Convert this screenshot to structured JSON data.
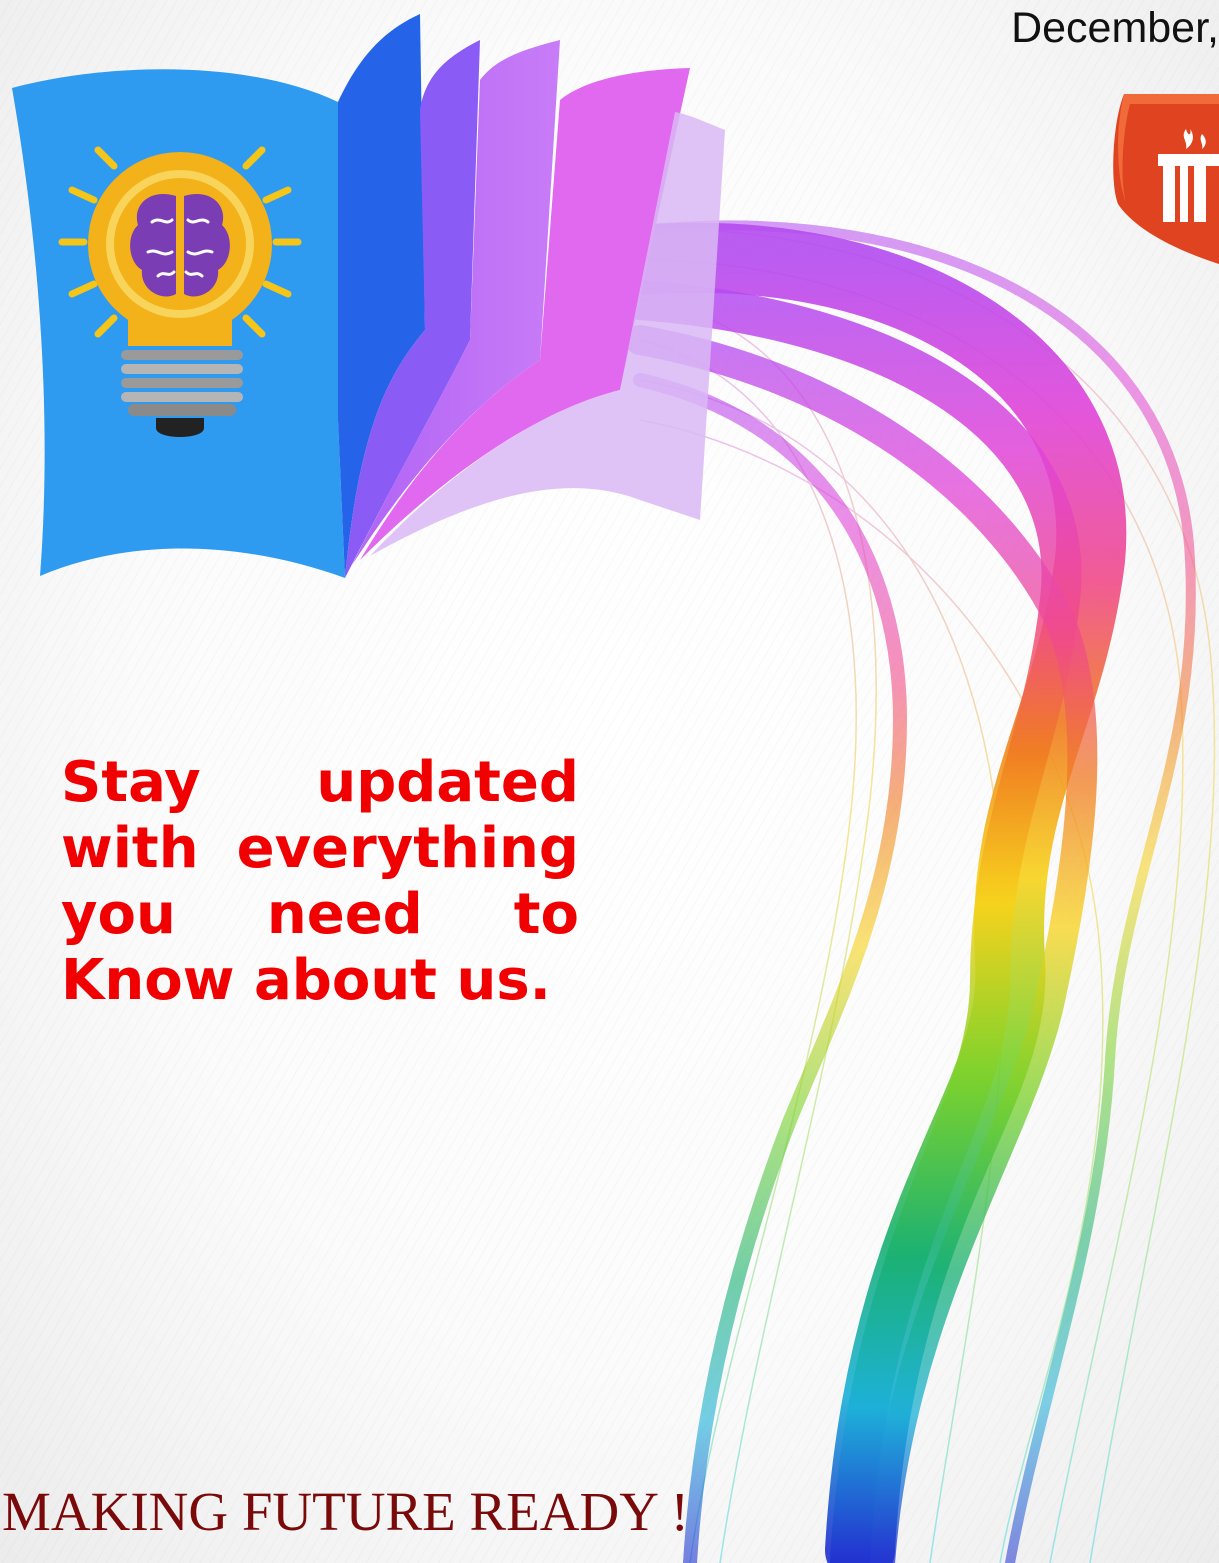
{
  "header": {
    "date_text": "December,"
  },
  "tagline": {
    "text": "Stay updated with everything you need to Know about us."
  },
  "footer": {
    "slogan": "MAKING FUTURE READY !"
  },
  "colors": {
    "tagline": "#f00000",
    "slogan": "#7a0a0a",
    "book_cover": "#2f9bf0",
    "logo": "#e0431f"
  }
}
